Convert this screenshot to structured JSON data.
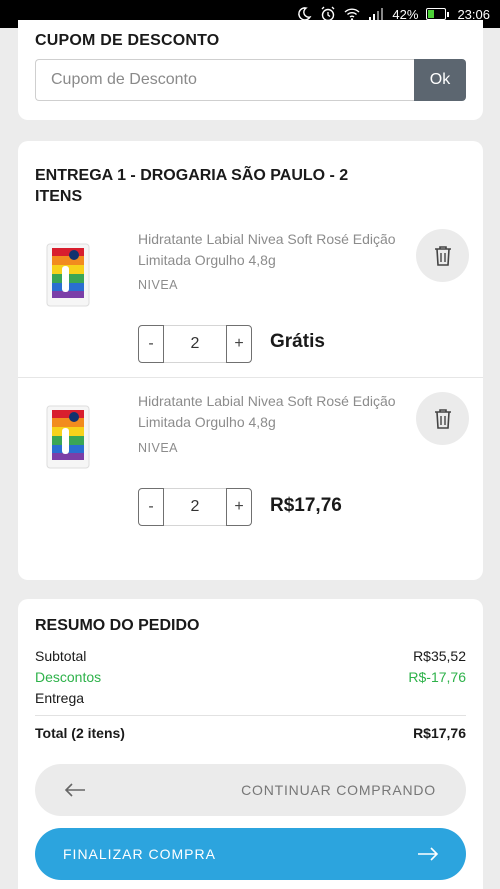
{
  "status_bar": {
    "battery": "42%",
    "battery_level": 0.42,
    "time": "23:06",
    "icons": [
      "do-not-disturb-moon-icon",
      "alarm-icon",
      "wifi-icon",
      "signal-icon",
      "battery-icon"
    ]
  },
  "coupon": {
    "title": "CUPOM DE DESCONTO",
    "placeholder": "Cupom de Desconto",
    "value": "",
    "button": "Ok"
  },
  "delivery": {
    "title": "ENTREGA 1 - DROGARIA SÃO PAULO - 2 ITENS",
    "items": [
      {
        "name": "Hidratante Labial Nivea Soft Rosé Edição Limitada Orgulho 4,8g",
        "brand": "NIVEA",
        "minus": "-",
        "qty": "2",
        "plus": "+",
        "price": "Grátis",
        "delete_icon": "trash-icon"
      },
      {
        "name": "Hidratante Labial Nivea Soft Rosé Edição Limitada Orgulho 4,8g",
        "brand": "NIVEA",
        "minus": "-",
        "qty": "2",
        "plus": "+",
        "price": "R$17,76",
        "delete_icon": "trash-icon"
      }
    ]
  },
  "summary": {
    "title": "RESUMO DO PEDIDO",
    "subtotal_label": "Subtotal",
    "subtotal_value": "R$35,52",
    "discount_label": "Descontos",
    "discount_value": "R$-17,76",
    "delivery_label": "Entrega",
    "delivery_value": "",
    "total_label": "Total (2 itens)",
    "total_value": "R$17,76",
    "continue_label": "CONTINUAR COMPRANDO",
    "finish_label": "FINALIZAR COMPRA"
  },
  "colors": {
    "accent": "#2ca4de",
    "discount": "#2eb24a",
    "ok_button": "#5c6670",
    "background": "#ececec"
  }
}
